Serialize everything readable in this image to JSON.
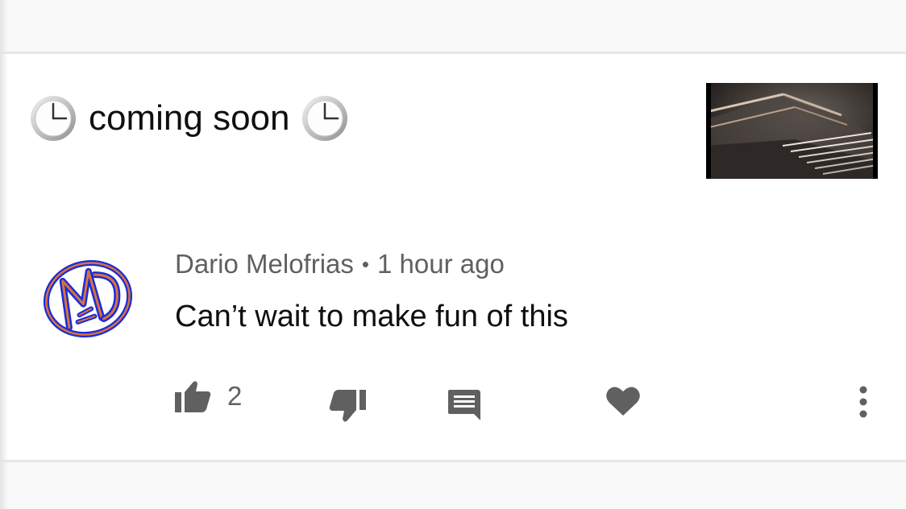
{
  "post": {
    "title": "coming soon",
    "leading_icon": "clock-icon",
    "trailing_icon": "clock-icon",
    "thumbnail": "video-thumbnail-stairs"
  },
  "comment": {
    "author": "Dario Melofrias",
    "separator": "•",
    "timestamp": "1 hour ago",
    "text": "Can’t wait to make fun of this",
    "like_count": "2"
  },
  "actions": {
    "like_icon": "thumbs-up-icon",
    "dislike_icon": "thumbs-down-icon",
    "reply_icon": "comment-icon",
    "heart_icon": "heart-icon",
    "more_icon": "more-vertical-icon"
  },
  "colors": {
    "secondary_text": "#606060",
    "icon_gray": "#606060",
    "divider": "#e6e6e6"
  }
}
